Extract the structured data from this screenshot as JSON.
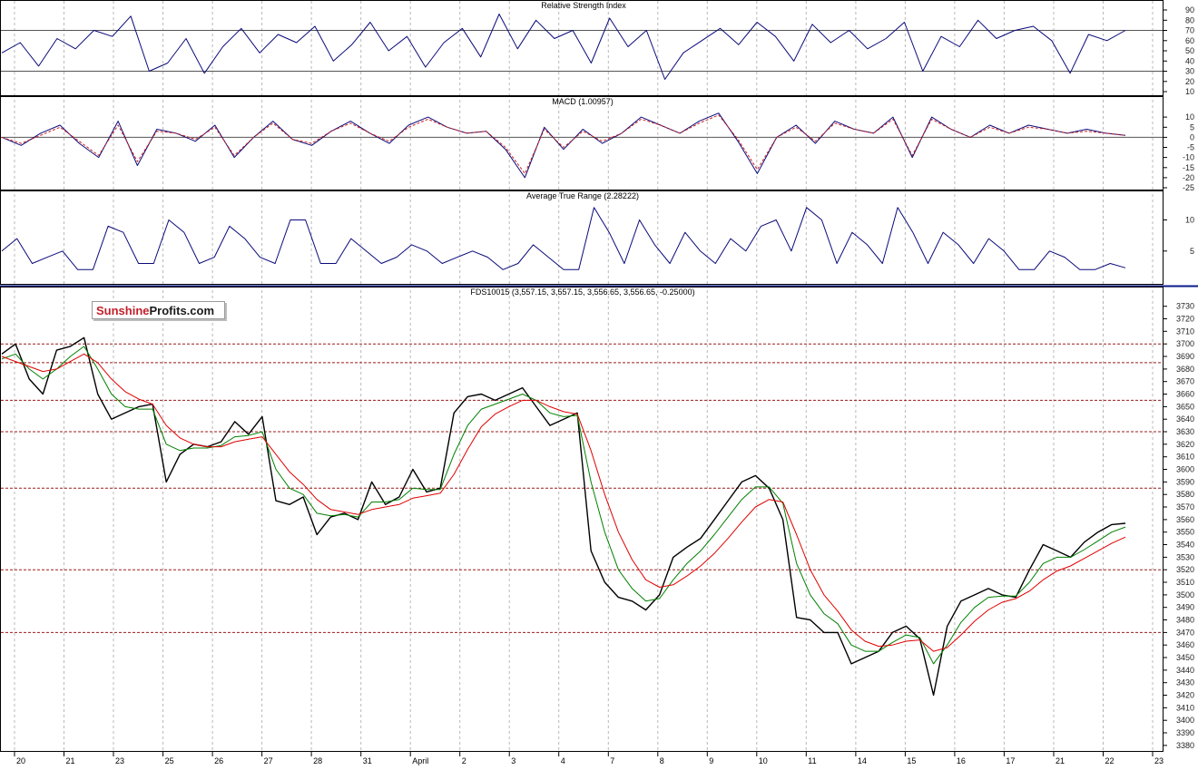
{
  "logo": {
    "part1": "Sunshine",
    "part2": "Profits.com"
  },
  "colors": {
    "indicator_line": "#0a0a7a",
    "macd_signal": "#cc2222",
    "price": "#000000",
    "ma_fast": "#008000",
    "ma_slow": "#e00000",
    "level_lines": "#9b1b1b",
    "separator": "#0a1a8a"
  },
  "chart_data": [
    {
      "type": "line",
      "title": "Relative Strength Index",
      "ylim": [
        10,
        90
      ],
      "y_ticks": [
        10,
        20,
        30,
        40,
        50,
        60,
        70,
        80,
        90
      ],
      "reference_lines": [
        30,
        70
      ],
      "series": [
        {
          "values": [
            48,
            58,
            35,
            62,
            52,
            70,
            64,
            84,
            30,
            38,
            62,
            28,
            54,
            72,
            48,
            66,
            58,
            74,
            40,
            56,
            78,
            50,
            64,
            34,
            58,
            72,
            44,
            86,
            52,
            80,
            62,
            70,
            38,
            82,
            54,
            70,
            22,
            48,
            60,
            72,
            56,
            78,
            64,
            40,
            76,
            58,
            70,
            52,
            62,
            78,
            30,
            64,
            54,
            80,
            62,
            70,
            74,
            60,
            28,
            66,
            60,
            70
          ]
        }
      ]
    },
    {
      "type": "line",
      "title": "MACD (1.00957)",
      "ylim": [
        -25,
        15
      ],
      "y_ticks": [
        10,
        5,
        0,
        -5,
        -10,
        -15,
        -20,
        -25
      ],
      "series": [
        {
          "name": "MACD",
          "values": [
            0,
            -4,
            2,
            6,
            -3,
            -10,
            8,
            -14,
            4,
            2,
            -2,
            6,
            -10,
            0,
            8,
            -1,
            -4,
            3,
            8,
            2,
            -3,
            6,
            10,
            5,
            2,
            3,
            -6,
            -20,
            5,
            -6,
            4,
            -3,
            2,
            10,
            6,
            2,
            8,
            12,
            -2,
            -18,
            0,
            6,
            -3,
            8,
            4,
            2,
            10,
            -10,
            10,
            4,
            0,
            6,
            2,
            6,
            4,
            2,
            4,
            2,
            1
          ]
        },
        {
          "name": "Signal",
          "values": [
            0,
            -3,
            1,
            5,
            -2,
            -9,
            6,
            -12,
            3,
            2,
            -1,
            5,
            -9,
            0,
            7,
            -1,
            -3,
            3,
            7,
            2,
            -2,
            5,
            9,
            5,
            2,
            3,
            -5,
            -18,
            4,
            -5,
            3,
            -2,
            2,
            9,
            6,
            2,
            7,
            11,
            -1,
            -16,
            0,
            5,
            -2,
            7,
            4,
            2,
            9,
            -9,
            9,
            4,
            0,
            5,
            2,
            5,
            4,
            2,
            3,
            2,
            1
          ]
        }
      ]
    },
    {
      "type": "line",
      "title": "Average True Range (2.28222)",
      "ylim": [
        0,
        13
      ],
      "y_ticks": [
        10,
        5
      ],
      "series": [
        {
          "values": [
            5,
            7,
            3,
            4,
            5,
            2,
            2,
            9,
            8,
            3,
            3,
            10,
            8,
            3,
            4,
            9,
            7,
            4,
            3,
            10,
            10,
            3,
            3,
            7,
            5,
            3,
            4,
            6,
            5,
            3,
            4,
            5,
            4,
            2,
            3,
            6,
            4,
            2,
            2,
            12,
            8,
            3,
            10,
            6,
            3,
            8,
            5,
            3,
            7,
            5,
            9,
            10,
            5,
            12,
            10,
            3,
            8,
            6,
            3,
            12,
            8,
            3,
            8,
            6,
            3,
            7,
            5,
            2,
            2,
            5,
            4,
            2,
            2,
            3,
            2.3
          ]
        }
      ]
    },
    {
      "type": "line",
      "title": "FDS10015 (3,557.15, 3,557.15, 3,556.65, 3,556.65, -0.25000)",
      "ylim": [
        3377,
        3737
      ],
      "y_ticks": [
        3730,
        3720,
        3710,
        3700,
        3690,
        3680,
        3670,
        3660,
        3650,
        3640,
        3630,
        3620,
        3610,
        3600,
        3590,
        3580,
        3570,
        3560,
        3550,
        3540,
        3530,
        3520,
        3510,
        3500,
        3490,
        3480,
        3470,
        3460,
        3450,
        3440,
        3430,
        3420,
        3410,
        3400,
        3390,
        3380
      ],
      "reference_lines": [
        3700,
        3685,
        3655,
        3630,
        3585,
        3520,
        3470
      ],
      "x_date_labels": [
        "20",
        "21",
        "23",
        "25",
        "26",
        "27",
        "28",
        "31",
        "April",
        "2",
        "3",
        "4",
        "7",
        "8",
        "9",
        "10",
        "11",
        "14",
        "15",
        "16",
        "17",
        "21",
        "22",
        "23"
      ],
      "series": [
        {
          "name": "Price",
          "values": [
            3692,
            3700,
            3672,
            3660,
            3695,
            3698,
            3705,
            3660,
            3640,
            3645,
            3650,
            3652,
            3590,
            3612,
            3620,
            3618,
            3622,
            3638,
            3628,
            3642,
            3575,
            3572,
            3578,
            3548,
            3562,
            3565,
            3560,
            3590,
            3572,
            3578,
            3600,
            3582,
            3585,
            3645,
            3658,
            3660,
            3655,
            3660,
            3665,
            3650,
            3635,
            3640,
            3645,
            3535,
            3510,
            3498,
            3495,
            3488,
            3500,
            3530,
            3538,
            3545,
            3560,
            3575,
            3590,
            3595,
            3585,
            3560,
            3482,
            3480,
            3470,
            3470,
            3445,
            3450,
            3455,
            3470,
            3475,
            3465,
            3420,
            3475,
            3495,
            3500,
            3505,
            3500,
            3498,
            3520,
            3540,
            3535,
            3530,
            3542,
            3550,
            3556,
            3557
          ]
        },
        {
          "name": "MA fast",
          "values": [
            3688,
            3692,
            3680,
            3672,
            3680,
            3690,
            3698,
            3680,
            3660,
            3650,
            3648,
            3648,
            3620,
            3615,
            3617,
            3617,
            3619,
            3626,
            3627,
            3630,
            3600,
            3585,
            3580,
            3565,
            3563,
            3564,
            3562,
            3574,
            3574,
            3576,
            3585,
            3584,
            3584,
            3612,
            3635,
            3648,
            3652,
            3656,
            3660,
            3655,
            3645,
            3642,
            3643,
            3590,
            3550,
            3520,
            3505,
            3495,
            3497,
            3512,
            3525,
            3535,
            3548,
            3562,
            3576,
            3586,
            3586,
            3573,
            3525,
            3500,
            3485,
            3477,
            3460,
            3455,
            3455,
            3462,
            3468,
            3466,
            3445,
            3460,
            3478,
            3490,
            3498,
            3499,
            3499,
            3510,
            3525,
            3530,
            3530,
            3536,
            3543,
            3550,
            3554
          ]
        },
        {
          "name": "MA slow",
          "values": [
            3690,
            3686,
            3682,
            3678,
            3680,
            3686,
            3692,
            3685,
            3672,
            3662,
            3656,
            3652,
            3635,
            3625,
            3620,
            3618,
            3618,
            3622,
            3624,
            3626,
            3612,
            3598,
            3588,
            3576,
            3568,
            3566,
            3564,
            3568,
            3570,
            3572,
            3577,
            3579,
            3581,
            3596,
            3616,
            3634,
            3644,
            3650,
            3655,
            3655,
            3650,
            3646,
            3644,
            3615,
            3580,
            3550,
            3528,
            3512,
            3506,
            3508,
            3515,
            3523,
            3533,
            3545,
            3558,
            3570,
            3576,
            3574,
            3548,
            3520,
            3500,
            3487,
            3472,
            3463,
            3459,
            3460,
            3463,
            3464,
            3455,
            3458,
            3468,
            3479,
            3488,
            3494,
            3497,
            3503,
            3512,
            3519,
            3523,
            3529,
            3535,
            3541,
            3546
          ]
        }
      ]
    }
  ]
}
